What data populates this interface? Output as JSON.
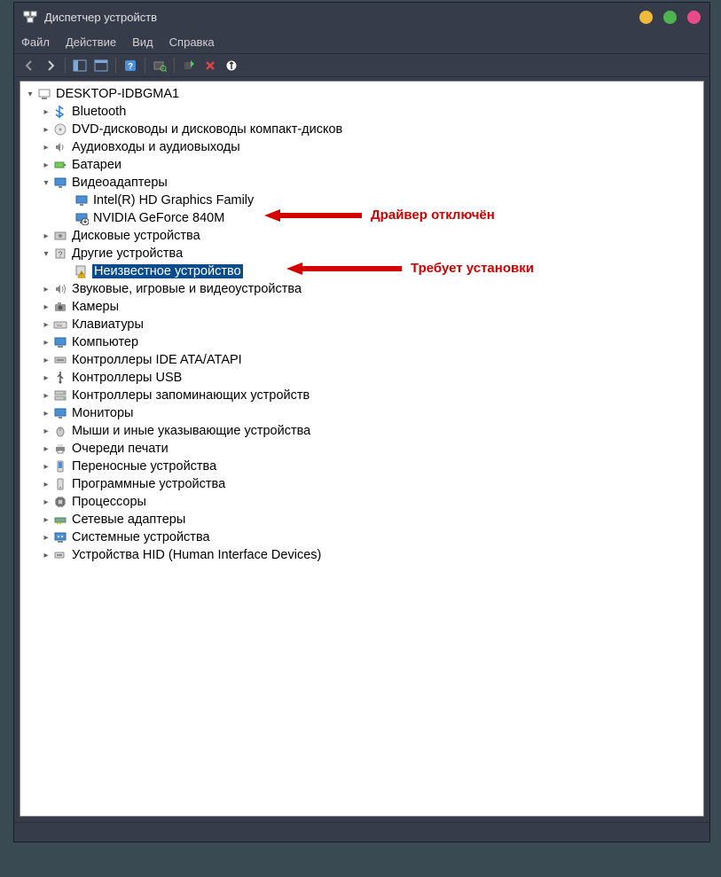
{
  "window": {
    "title": "Диспетчер устройств"
  },
  "menu": {
    "file": "Файл",
    "action": "Действие",
    "view": "Вид",
    "help": "Справка"
  },
  "tree": {
    "root": "DESKTOP-IDBGMA1",
    "bluetooth": "Bluetooth",
    "dvd": "DVD-дисководы и дисководы компакт-дисков",
    "audio": "Аудиовходы и аудиовыходы",
    "battery": "Батареи",
    "video": "Видеоадаптеры",
    "video_intel": "Intel(R) HD Graphics Family",
    "video_nvidia": "NVIDIA GeForce 840M",
    "disk": "Дисковые устройства",
    "other": "Другие устройства",
    "other_unknown": "Неизвестное устройство",
    "sound": "Звуковые, игровые и видеоустройства",
    "camera": "Камеры",
    "keyboard": "Клавиатуры",
    "computer": "Компьютер",
    "ide": "Контроллеры IDE ATA/ATAPI",
    "usb": "Контроллеры USB",
    "storage": "Контроллеры запоминающих устройств",
    "monitor": "Мониторы",
    "mouse": "Мыши и иные указывающие устройства",
    "printq": "Очереди печати",
    "portable": "Переносные устройства",
    "software": "Программные устройства",
    "cpu": "Процессоры",
    "network": "Сетевые адаптеры",
    "system": "Системные устройства",
    "hid": "Устройства HID (Human Interface Devices)"
  },
  "annotations": {
    "driver_disabled": "Драйвер отключён",
    "needs_install": "Требует установки"
  }
}
